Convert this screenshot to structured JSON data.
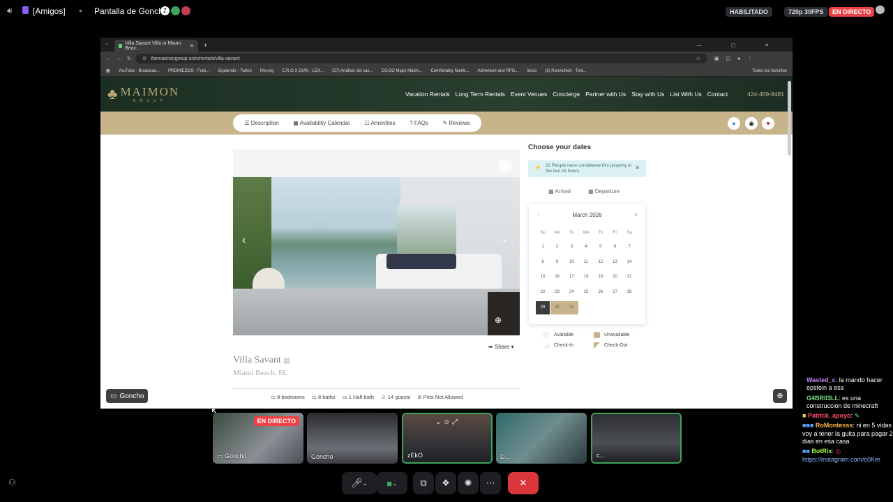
{
  "topbar": {
    "channel": "[Amigos]",
    "screen_title": "Pantalla de Goncho",
    "enabled_badge": "HABILITADO",
    "quality": "720p 30FPS",
    "live": "EN DIRECTO"
  },
  "browser": {
    "tab_title": "Villa Savant Villa in Miami Beac...",
    "url": "themaimongroup.com/rentals/villa-savant",
    "bookmarks": [
      "YouTube - Broadcas...",
      "PROMIEDOS - Futb...",
      "Siguiendo - Twitch",
      "hltv.org",
      "C.R.O X DUKI - LEX...",
      "(57) Análisis del cas...",
      "CS:GO Major Match...",
      "Comfortably Numb...",
      "Adventure and RPG...",
      "Inicio",
      "(3) Ronvichich - Twit..."
    ],
    "all_favorites": "Todos los favoritos"
  },
  "site": {
    "logo": "MAIMON",
    "logo_sub": "GROUP",
    "nav": [
      "Vacation Rentals",
      "Long Term Rentals",
      "Event Venues",
      "Concierge",
      "Partner with Us",
      "Stay with Us",
      "List With Us",
      "Contact"
    ],
    "phone": "424-459-8481",
    "subtabs": [
      "Description",
      "Availability Calendar",
      "Amenities",
      "FAQs",
      "Reviews"
    ],
    "choose_dates": "Choose your dates",
    "notice": "22 People have considered this property in the last 24 hours",
    "arrival": "Arrival",
    "departure": "Departure",
    "calendar": {
      "month": "March 2026",
      "weekdays": [
        "Su",
        "Mo",
        "Tu",
        "We",
        "Th",
        "Fr",
        "Sa"
      ],
      "weeks": [
        [
          "1",
          "2",
          "3",
          "4",
          "5",
          "6",
          "7"
        ],
        [
          "8",
          "9",
          "10",
          "11",
          "12",
          "13",
          "14"
        ],
        [
          "15",
          "16",
          "17",
          "18",
          "19",
          "20",
          "21"
        ],
        [
          "22",
          "23",
          "24",
          "25",
          "26",
          "27",
          "28"
        ],
        [
          "29",
          "30",
          "31"
        ]
      ]
    },
    "legend": [
      "Available",
      "Unavailable",
      "Check-In",
      "Check-Out"
    ],
    "share": "Share",
    "villa_name": "Villa Savant",
    "location": "Miami Beach, FL",
    "specs": [
      "8 bedrooms",
      "8 baths",
      "1 Half bath",
      "14 guests",
      "Pets Not Allowed"
    ]
  },
  "stream_label": "Goncho",
  "participants": [
    {
      "name": "Goncho",
      "live": "EN DIRECTO"
    },
    {
      "name": "Goncho"
    },
    {
      "name": "zEkO"
    },
    {
      "name": "D..."
    },
    {
      "name": "c..."
    }
  ],
  "chat": [
    {
      "user": "Wasted_c",
      "text": ": la mando hacer epstein a esa",
      "color": "#c58af9"
    },
    {
      "user": "G4BRII3LL",
      "text": ": es una construccion de minecraft",
      "color": "#7ee08a"
    },
    {
      "user": "Patrick_apoyo",
      "text": ": ",
      "color": "#ff4d6d"
    },
    {
      "user": "RoMontesss",
      "text": ": ni en 5 vidas voy a tener la guita para pagar 2 dias en esa casa",
      "color": "#ffb84d"
    },
    {
      "user": "BotRix",
      "text": ": ",
      "color": "#a5ff4d"
    }
  ],
  "chat_link": "https://instagram.com/c0Ker"
}
